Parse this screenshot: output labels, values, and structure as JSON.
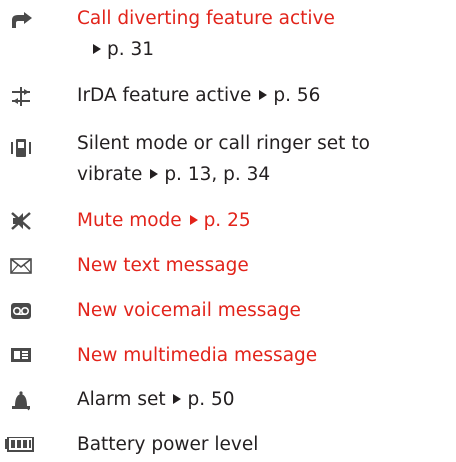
{
  "items": [
    {
      "icon": "call-divert-icon",
      "line1": "Call diverting feature active",
      "line2": "p. 31"
    },
    {
      "icon": "irda-icon",
      "text": "IrDA feature active",
      "ref": "p. 56"
    },
    {
      "icon": "vibrate-icon",
      "line1": "Silent mode or call ringer set to",
      "line2_prefix": "vibrate",
      "ref": "p. 13, p. 34"
    },
    {
      "icon": "mute-icon",
      "text": "Mute mode",
      "ref": "p. 25"
    },
    {
      "icon": "envelope-icon",
      "text": "New text message"
    },
    {
      "icon": "voicemail-icon",
      "text": "New voicemail message"
    },
    {
      "icon": "multimedia-message-icon",
      "text": "New multimedia message"
    },
    {
      "icon": "alarm-bell-icon",
      "text": "Alarm set",
      "ref": "p. 50"
    },
    {
      "icon": "battery-icon",
      "text": "Battery power level"
    }
  ],
  "colors": {
    "highlight": "#e2231a",
    "text": "#231f20",
    "icon": "#4a4a4a"
  }
}
